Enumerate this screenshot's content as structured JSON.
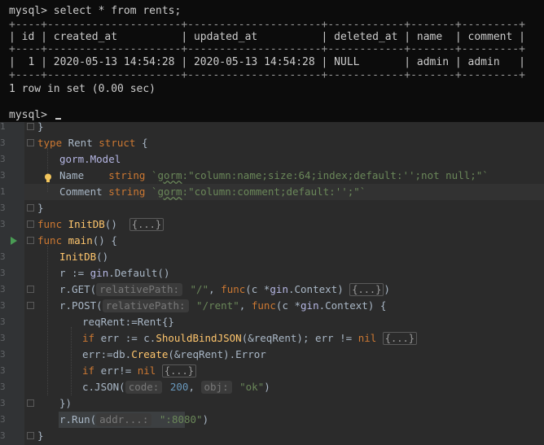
{
  "terminal": {
    "lines": [
      "mysql> select * from rents;",
      "+----+---------------------+---------------------+------------+-------+---------+",
      "| id | created_at          | updated_at          | deleted_at | name  | comment |",
      "+----+---------------------+---------------------+------------+-------+---------+",
      "|  1 | 2020-05-13 14:54:28 | 2020-05-13 14:54:28 | NULL       | admin | admin   |",
      "+----+---------------------+---------------------+------------+-------+---------+",
      "1 row in set (0.00 sec)",
      "",
      "mysql> "
    ]
  },
  "editor": {
    "gutter_numbers": [
      "1",
      "3",
      "3",
      "3",
      "3",
      "1",
      "3",
      "3",
      "3",
      "3",
      "3",
      "3",
      "3",
      "3",
      "3",
      "3",
      "3",
      "3",
      "3",
      "3"
    ],
    "code": {
      "brace_close_top": "}",
      "type_kw": "type",
      "type_name": " Rent ",
      "struct_kw": "struct",
      "struct_open": " {",
      "gorm_pkg": "gorm",
      "gorm_model": ".Model",
      "name_field": "Name",
      "name_type": "string",
      "name_tag_prefix": "`",
      "name_tag_gorm": "gorm",
      "name_tag_rest": ":\"column:name;size:64;index;default:'';not null;\"`",
      "comment_field": "Comment",
      "comment_type": "string",
      "comment_tag_prefix": "`",
      "comment_tag_gorm": "gorm",
      "comment_tag_rest": ":\"column:comment;default:'';\"`",
      "struct_close": "}",
      "func_kw": "func",
      "initdb_name": " InitDB",
      "initdb_sig": "()",
      "fold_body": "{...}",
      "main_name": " main",
      "main_sig": "() {",
      "call_initdb": "InitDB",
      "call_initdb_paren": "()",
      "r_assign": "r := ",
      "gin_pkg": "gin",
      "gin_default": ".Default()",
      "r_get": "r.GET(",
      "hint_relative_path": "relativePath:",
      "str_root": " \"/\"",
      "comma_func": ", ",
      "c_param": "(c *",
      "gin_context": ".Context",
      "close_paren_space": ") ",
      "close_paren": ")",
      "r_post": "r.POST(",
      "str_rent": " \"/rent\"",
      "post_tail": ") {",
      "reqrent_assign": "reqRent:=",
      "rent_literal": "Rent{}",
      "if_kw": "if",
      "err_assign": " err := c.",
      "should_bind": "ShouldBindJSON",
      "bind_args": "(&reqRent); err != ",
      "nil_kw": "nil",
      "db_line_pre": "err:=db.",
      "db_create": "Create",
      "db_line_post": "(&reqRent).Error",
      "if_err_pre": " err!= ",
      "c_json": "c.JSON(",
      "hint_code": "code:",
      "code_200": " 200",
      "comma": ",",
      "hint_obj": "obj:",
      "str_ok": " \"ok\"",
      "close_call": "})",
      "r_run": "r.Run(",
      "hint_addr": "addr...:",
      "str_port": " \":8080\"",
      "final_close": "}"
    }
  }
}
